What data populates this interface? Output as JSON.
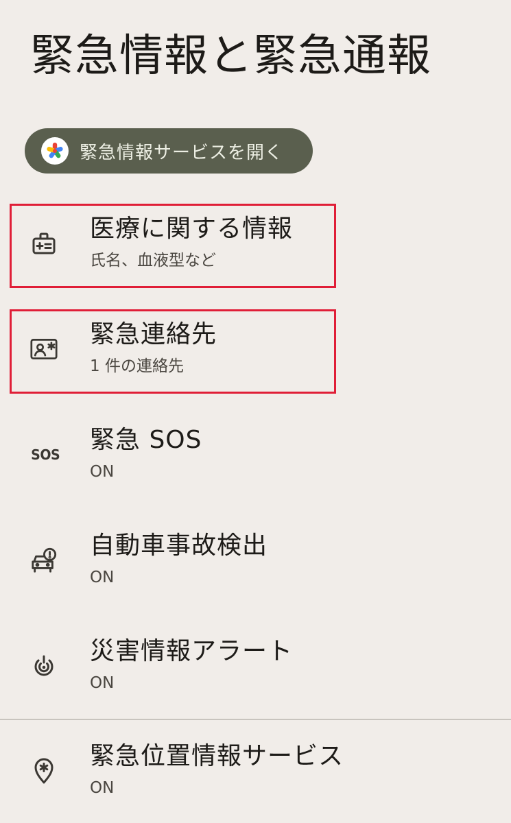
{
  "header": {
    "title": "緊急情報と緊急通報"
  },
  "open_service": {
    "label": "緊急情報サービスを開く",
    "logo_colors": [
      "#ea4335",
      "#4285f4",
      "#fbbc04",
      "#34a853"
    ]
  },
  "items": [
    {
      "icon": "medical-info-icon",
      "title": "医療に関する情報",
      "subtitle": "氏名、血液型など",
      "highlighted": true
    },
    {
      "icon": "emergency-contact-icon",
      "title": "緊急連絡先",
      "subtitle": "1 件の連絡先",
      "highlighted": true
    },
    {
      "icon": "sos-icon",
      "icon_text": "SOS",
      "title": "緊急 SOS",
      "subtitle": "ON",
      "highlighted": false
    },
    {
      "icon": "car-crash-icon",
      "title": "自動車事故検出",
      "subtitle": "ON",
      "highlighted": false
    },
    {
      "icon": "crisis-alert-icon",
      "title": "災害情報アラート",
      "subtitle": "ON",
      "highlighted": false
    },
    {
      "icon": "emergency-location-icon",
      "title": "緊急位置情報サービス",
      "subtitle": "ON",
      "highlighted": false
    }
  ],
  "colors": {
    "background": "#f1ede9",
    "button": "#5a5f4e",
    "highlight": "#e01e37"
  }
}
